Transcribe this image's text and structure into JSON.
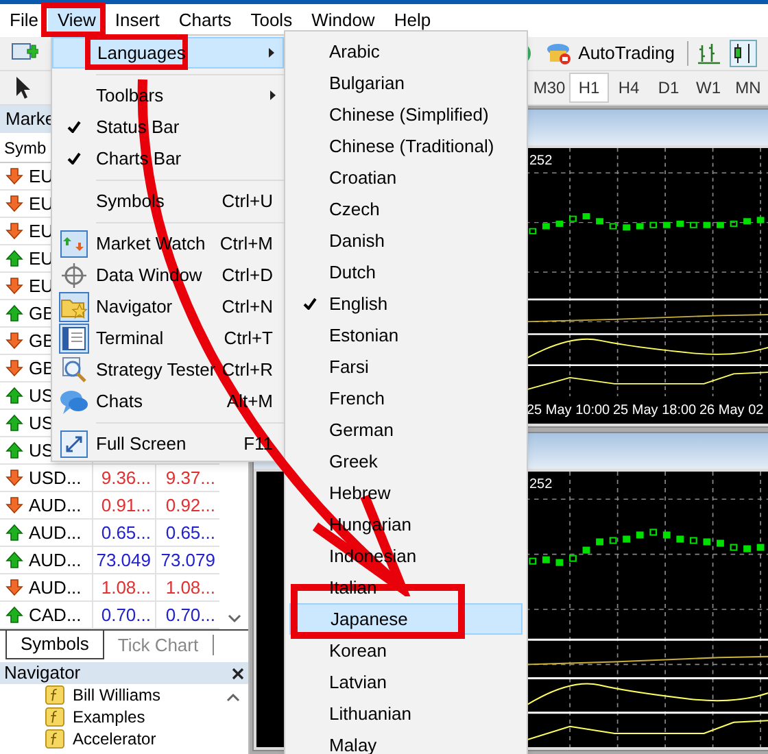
{
  "menu_bar": [
    {
      "label": "File",
      "selected": false
    },
    {
      "label": "View",
      "selected": true
    },
    {
      "label": "Insert",
      "selected": false
    },
    {
      "label": "Charts",
      "selected": false
    },
    {
      "label": "Tools",
      "selected": false
    },
    {
      "label": "Window",
      "selected": false
    },
    {
      "label": "Help",
      "selected": false
    }
  ],
  "toolbar": {
    "autotrading": "AutoTrading"
  },
  "timeframes": [
    {
      "label": "M30",
      "selected": false
    },
    {
      "label": "H1",
      "selected": true
    },
    {
      "label": "H4",
      "selected": false
    },
    {
      "label": "D1",
      "selected": false
    },
    {
      "label": "W1",
      "selected": false
    },
    {
      "label": "MN",
      "selected": false
    }
  ],
  "market_watch": {
    "title": "Marke",
    "column_1": "Symb",
    "rows": [
      {
        "symbol": "EU",
        "kind": "down"
      },
      {
        "symbol": "EU",
        "kind": "down"
      },
      {
        "symbol": "EU",
        "kind": "down"
      },
      {
        "symbol": "EU",
        "kind": "up"
      },
      {
        "symbol": "EU",
        "kind": "down"
      },
      {
        "symbol": "GB",
        "kind": "up"
      },
      {
        "symbol": "GB",
        "kind": "down"
      },
      {
        "symbol": "GB",
        "kind": "down"
      },
      {
        "symbol": "US",
        "kind": "up"
      },
      {
        "symbol": "US",
        "kind": "up"
      },
      {
        "symbol": "US",
        "kind": "up"
      },
      {
        "symbol": "USD...",
        "kind": "down",
        "bid": "9.36...",
        "ask": "9.37..."
      },
      {
        "symbol": "AUD...",
        "kind": "down",
        "bid": "0.91...",
        "ask": "0.92..."
      },
      {
        "symbol": "AUD...",
        "kind": "up",
        "bid": "0.65...",
        "ask": "0.65..."
      },
      {
        "symbol": "AUD...",
        "kind": "up",
        "bid": "73.049",
        "ask": "73.079"
      },
      {
        "symbol": "AUD...",
        "kind": "down",
        "bid": "1.08...",
        "ask": "1.08..."
      },
      {
        "symbol": "CAD...",
        "kind": "up",
        "bid": "0.70...",
        "ask": "0.70..."
      }
    ],
    "tabs": [
      {
        "label": "Symbols",
        "selected": true
      },
      {
        "label": "Tick Chart",
        "selected": false
      }
    ]
  },
  "navigator": {
    "title": "Navigator",
    "items": [
      {
        "label": "Bill Williams"
      },
      {
        "label": "Examples"
      },
      {
        "label": "Accelerator"
      }
    ]
  },
  "charts": [
    {
      "price_label": "252",
      "dates": [
        "25 May 10:00",
        "25 May 18:00",
        "26 May 02"
      ]
    },
    {
      "price_label": "252"
    }
  ],
  "view_menu": [
    {
      "kind": "item",
      "label": "Languages",
      "submenu": true,
      "selected": true,
      "checked": false
    },
    {
      "kind": "separator"
    },
    {
      "kind": "item",
      "label": "Toolbars",
      "submenu": true,
      "selected": false,
      "checked": false
    },
    {
      "kind": "item",
      "label": "Status Bar",
      "submenu": false,
      "selected": false,
      "checked": true
    },
    {
      "kind": "item",
      "label": "Charts Bar",
      "submenu": false,
      "selected": false,
      "checked": true
    },
    {
      "kind": "separator"
    },
    {
      "kind": "item",
      "label": "Symbols",
      "shortcut": "Ctrl+U",
      "submenu": false,
      "selected": false,
      "checked": false
    },
    {
      "kind": "separator"
    },
    {
      "kind": "item",
      "label": "Market Watch",
      "shortcut": "Ctrl+M",
      "submenu": false,
      "selected": false,
      "checked": false
    },
    {
      "kind": "item",
      "label": "Data Window",
      "shortcut": "Ctrl+D",
      "submenu": false,
      "selected": false,
      "checked": false
    },
    {
      "kind": "item",
      "label": "Navigator",
      "shortcut": "Ctrl+N",
      "submenu": false,
      "selected": false,
      "checked": false
    },
    {
      "kind": "item",
      "label": "Terminal",
      "shortcut": "Ctrl+T",
      "submenu": false,
      "selected": false,
      "checked": false
    },
    {
      "kind": "item",
      "label": "Strategy Tester",
      "shortcut": "Ctrl+R",
      "submenu": false,
      "selected": false,
      "checked": false
    },
    {
      "kind": "item",
      "label": "Chats",
      "shortcut": "Alt+M",
      "submenu": false,
      "selected": false,
      "checked": false
    },
    {
      "kind": "separator"
    },
    {
      "kind": "item",
      "label": "Full Screen",
      "shortcut": "F11",
      "submenu": false,
      "selected": false,
      "checked": false
    }
  ],
  "languages_menu": [
    {
      "label": "Arabic",
      "checked": false,
      "selected": false
    },
    {
      "label": "Bulgarian",
      "checked": false,
      "selected": false
    },
    {
      "label": "Chinese (Simplified)",
      "checked": false,
      "selected": false
    },
    {
      "label": "Chinese (Traditional)",
      "checked": false,
      "selected": false
    },
    {
      "label": "Croatian",
      "checked": false,
      "selected": false
    },
    {
      "label": "Czech",
      "checked": false,
      "selected": false
    },
    {
      "label": "Danish",
      "checked": false,
      "selected": false
    },
    {
      "label": "Dutch",
      "checked": false,
      "selected": false
    },
    {
      "label": "English",
      "checked": true,
      "selected": false
    },
    {
      "label": "Estonian",
      "checked": false,
      "selected": false
    },
    {
      "label": "Farsi",
      "checked": false,
      "selected": false
    },
    {
      "label": "French",
      "checked": false,
      "selected": false
    },
    {
      "label": "German",
      "checked": false,
      "selected": false
    },
    {
      "label": "Greek",
      "checked": false,
      "selected": false
    },
    {
      "label": "Hebrew",
      "checked": false,
      "selected": false
    },
    {
      "label": "Hungarian",
      "checked": false,
      "selected": false
    },
    {
      "label": "Indonesian",
      "checked": false,
      "selected": false
    },
    {
      "label": "Italian",
      "checked": false,
      "selected": false
    },
    {
      "label": "Japanese",
      "checked": false,
      "selected": true
    },
    {
      "label": "Korean",
      "checked": false,
      "selected": false
    },
    {
      "label": "Latvian",
      "checked": false,
      "selected": false
    },
    {
      "label": "Lithuanian",
      "checked": false,
      "selected": false
    },
    {
      "label": "Malay",
      "checked": false,
      "selected": false
    }
  ]
}
